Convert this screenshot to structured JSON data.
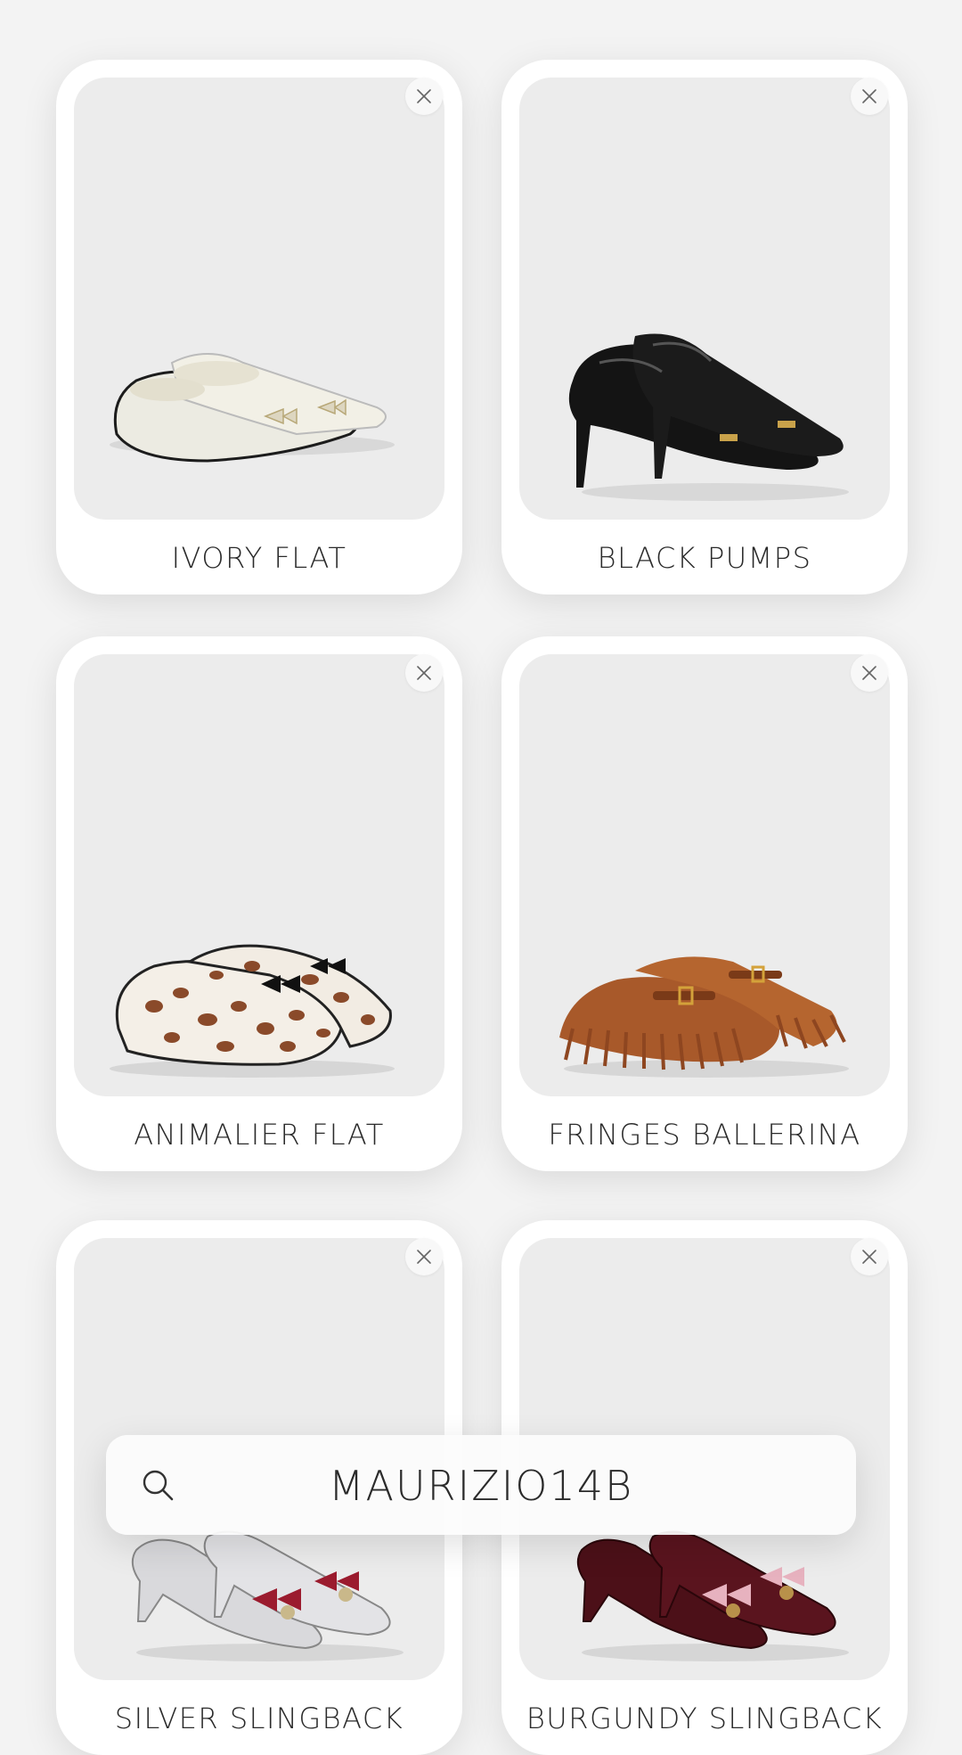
{
  "products": [
    {
      "name": "IVORY FLAT",
      "remove_icon": "close-icon"
    },
    {
      "name": "BLACK PUMPS",
      "remove_icon": "close-icon"
    },
    {
      "name": "ANIMALIER FLAT",
      "remove_icon": "close-icon"
    },
    {
      "name": "FRINGES BALLERINA",
      "remove_icon": "close-icon"
    },
    {
      "name": "SILVER SLINGBACK",
      "remove_icon": "close-icon"
    },
    {
      "name": "BURGUNDY SLINGBACK",
      "remove_icon": "close-icon"
    }
  ],
  "search": {
    "brand": "MAURIZIO14B",
    "icon": "search-icon"
  },
  "colors": {
    "background": "#f3f3f3",
    "card": "#ffffff",
    "photo_bg": "#ececec",
    "text": "#2a2a2a"
  }
}
